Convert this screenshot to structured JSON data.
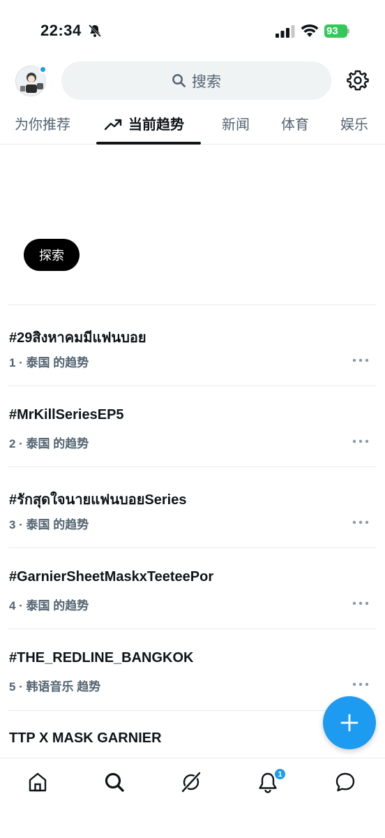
{
  "status_bar": {
    "time": "22:34",
    "battery": "93",
    "icons": [
      "bell-off-icon",
      "signal-icon",
      "wifi-icon",
      "battery-icon"
    ]
  },
  "header": {
    "search_placeholder": "搜索",
    "icons": [
      "avatar",
      "search-icon",
      "gear-icon"
    ]
  },
  "tabs": [
    {
      "label": "为你推荐",
      "active": false
    },
    {
      "label": "当前趋势",
      "active": true
    },
    {
      "label": "新闻",
      "active": false
    },
    {
      "label": "体育",
      "active": false
    },
    {
      "label": "娱乐",
      "active": false
    }
  ],
  "explore_label": "探索",
  "trends": [
    {
      "name": "#29สิงหาคมมีแฟนบอย",
      "meta": "1 · 泰国 的趋势"
    },
    {
      "name": "#MrKillSeriesEP5",
      "meta": "2 · 泰国 的趋势"
    },
    {
      "name": "#รักสุดใจนายแฟนบอยSeries",
      "meta": "3 · 泰国 的趋势"
    },
    {
      "name": "#GarnierSheetMaskxTeeteePor",
      "meta": "4 · 泰国 的趋势"
    },
    {
      "name": "#THE_REDLINE_BANGKOK",
      "meta": "5 · 韩语音乐 趋势"
    },
    {
      "name": "TTP X MASK GARNIER",
      "meta": ""
    }
  ],
  "bottom_nav": {
    "notification_badge": "1",
    "icons": [
      "home-icon",
      "search-icon",
      "grok-icon",
      "bell-icon",
      "messages-icon"
    ]
  },
  "colors": {
    "accent": "#1d9bf0",
    "text_primary": "#0f1419",
    "text_secondary": "#536471",
    "battery_green": "#34c759"
  }
}
